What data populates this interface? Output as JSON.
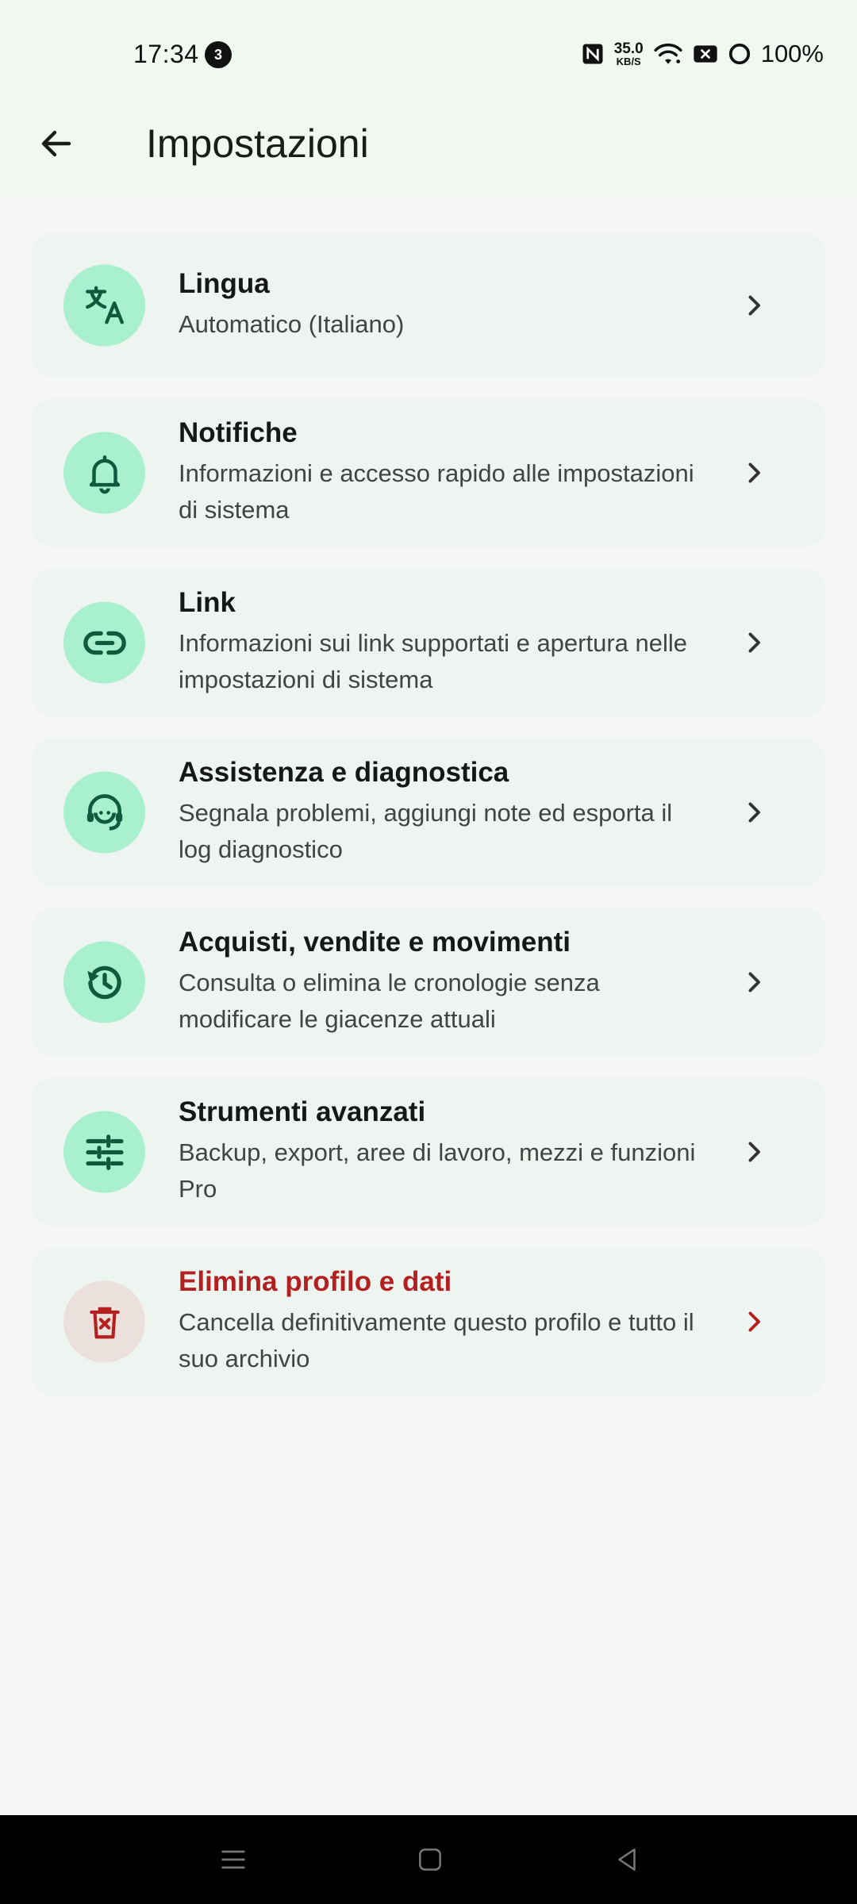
{
  "status": {
    "time": "17:34",
    "notification_count": "3",
    "net_speed_value": "35.0",
    "net_speed_unit": "KB/S",
    "battery": "100%"
  },
  "appbar": {
    "title": "Impostazioni",
    "back_icon": "arrow-back-icon"
  },
  "items": [
    {
      "title": "Lingua",
      "subtitle": "Automatico (Italiano)",
      "icon": "translate-icon"
    },
    {
      "title": "Notifiche",
      "subtitle": "Informazioni e accesso rapido alle impostazioni di sistema",
      "icon": "bell-icon"
    },
    {
      "title": "Link",
      "subtitle": "Informazioni sui link supportati e apertura nelle impostazioni di sistema",
      "icon": "link-icon"
    },
    {
      "title": "Assistenza e diagnostica",
      "subtitle": "Segnala problemi, aggiungi note ed esporta il log diagnostico",
      "icon": "support-agent-icon"
    },
    {
      "title": "Acquisti, vendite e movimenti",
      "subtitle": "Consulta o elimina le cronologie senza modificare le giacenze attuali",
      "icon": "history-icon"
    },
    {
      "title": "Strumenti avanzati",
      "subtitle": "Backup, export, aree di lavoro, mezzi e funzioni Pro",
      "icon": "tune-icon"
    },
    {
      "title": "Elimina profilo e dati",
      "subtitle": "Cancella definitivamente questo profilo e tutto il suo archivio",
      "icon": "delete-icon"
    }
  ],
  "colors": {
    "accent_circle": "#a9f0cf",
    "icon_color": "#0f5a3c",
    "danger": "#b3201f",
    "card_bg": "#eef4ef"
  },
  "navbar": {
    "menu_icon": "recents-icon",
    "home_icon": "home-icon",
    "back_icon": "back-triangle-icon"
  }
}
